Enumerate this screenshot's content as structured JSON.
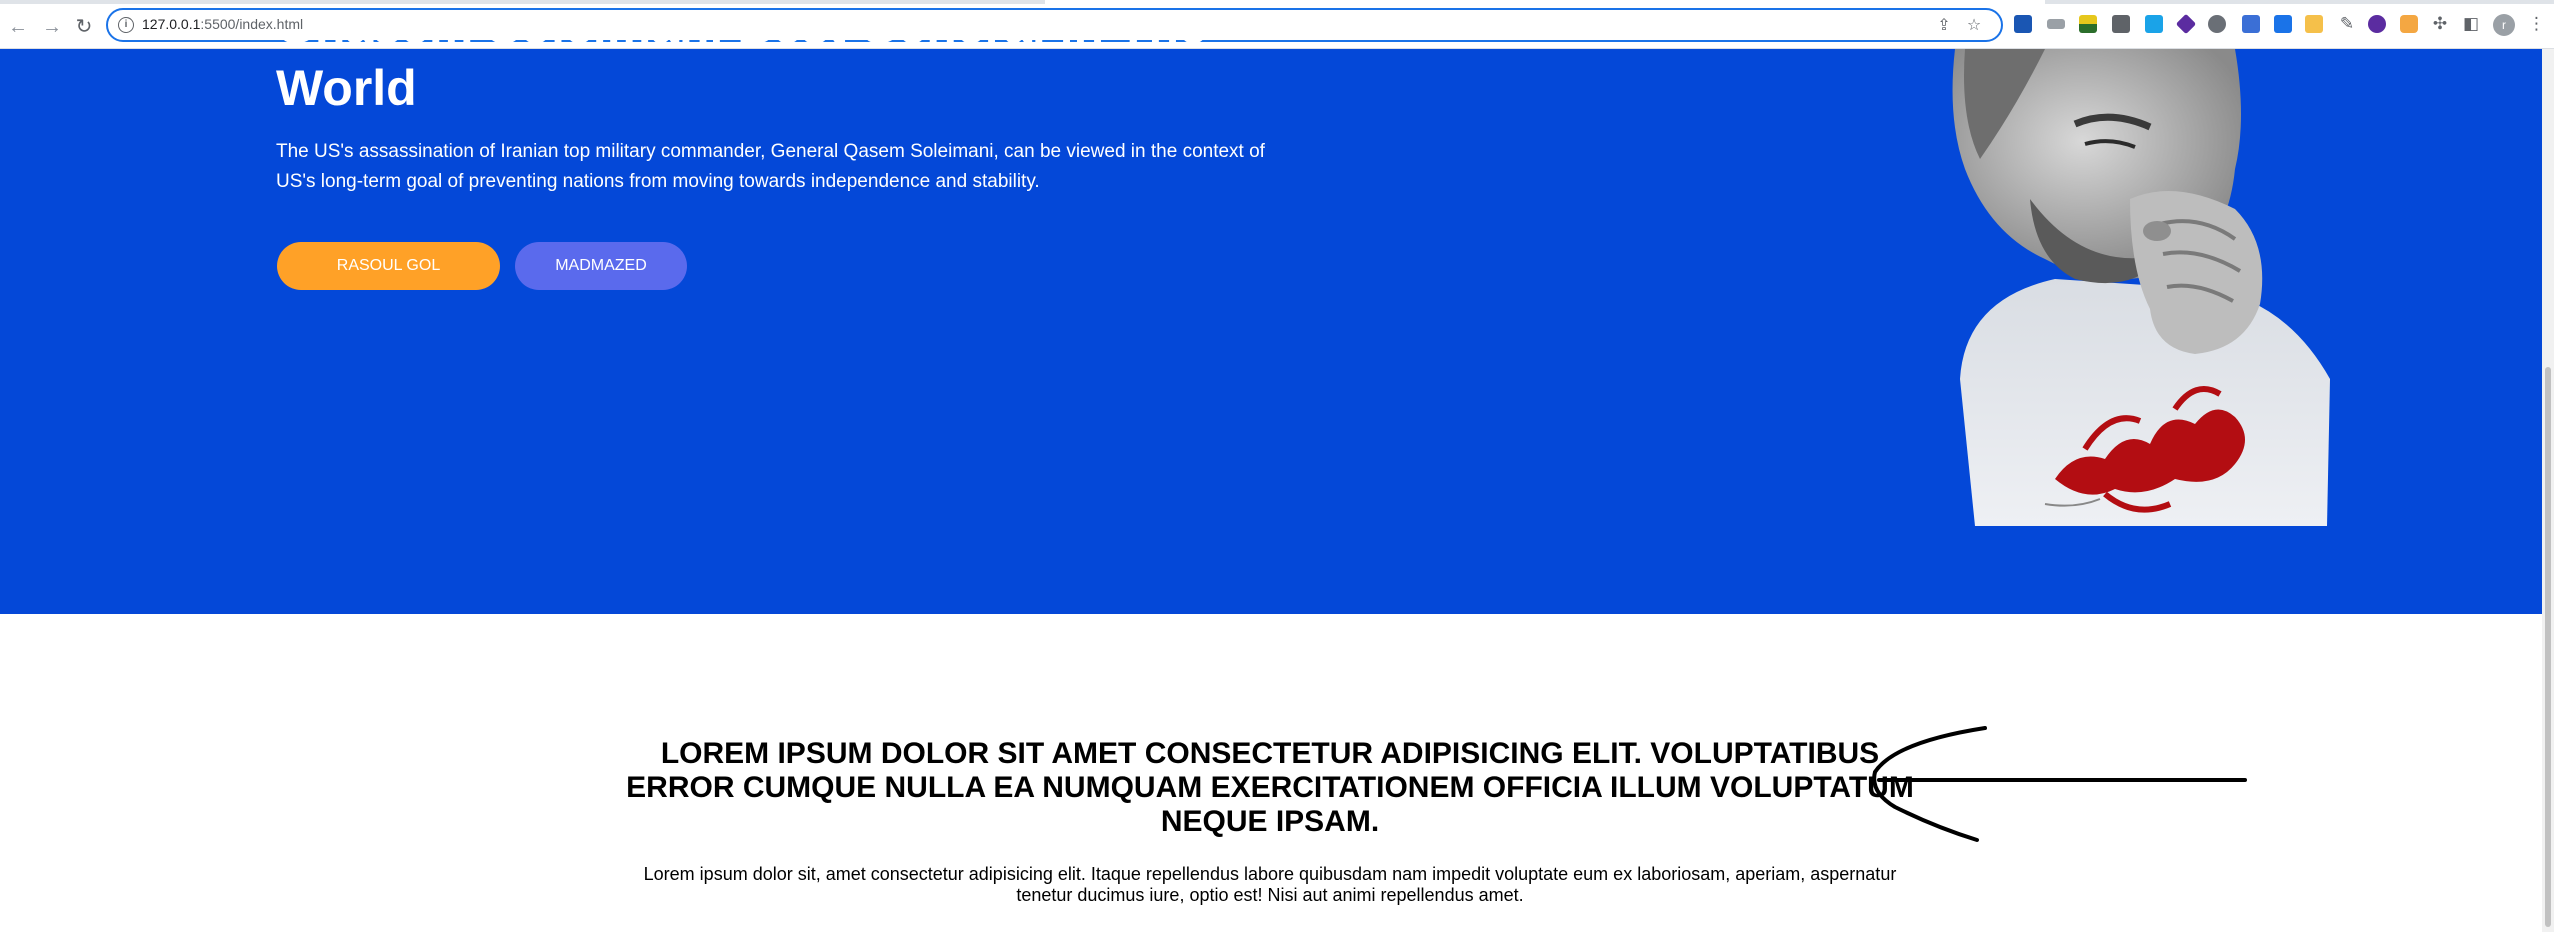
{
  "browser": {
    "url_host": "127.0.0.1",
    "url_rest": ":5500/index.html",
    "profile_initial": "r"
  },
  "hero": {
    "title_line1": "Ghasem Soleimani Best General in The",
    "title_line2": "World",
    "description": "The US's assassination of Iranian top military commander, General Qasem Soleimani, can be viewed in the context of US's long-term goal of preventing nations from moving towards independence and stability.",
    "primary_button": "RASOUL GOL",
    "secondary_button": "MADMAZED",
    "colors": {
      "background": "#0448d8",
      "primary": "#ffa127",
      "secondary": "#5a6aed"
    }
  },
  "content": {
    "heading": "LOREM IPSUM DOLOR SIT AMET CONSECTETUR ADIPISICING ELIT. VOLUPTATIBUS ERROR CUMQUE NULLA EA NUMQUAM EXERCITATIONEM OFFICIA ILLUM VOLUPTATUM NEQUE IPSAM.",
    "text": "Lorem ipsum dolor sit, amet consectetur adipisicing elit. Itaque repellendus labore quibusdam nam impedit voluptate eum ex laboriosam, aperiam, aspernatur tenetur ducimus iure, optio est! Nisi aut animi repellendus amet."
  }
}
